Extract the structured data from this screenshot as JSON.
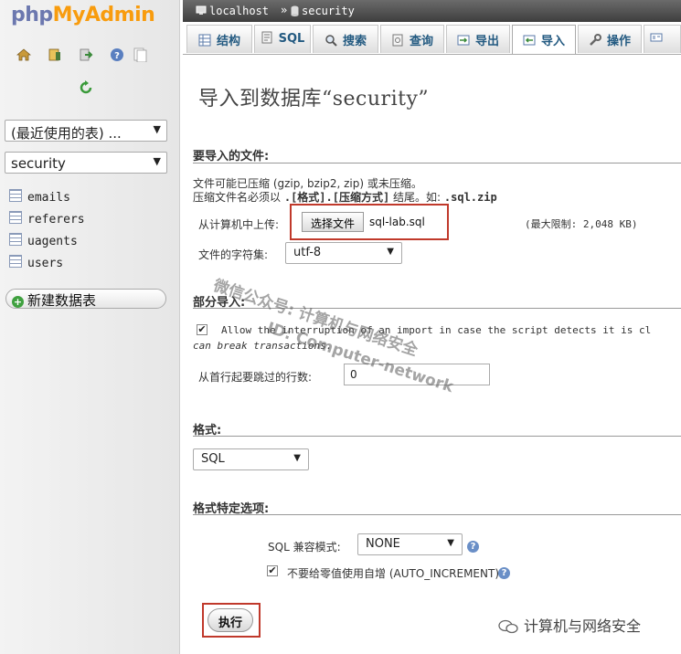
{
  "logo": {
    "php": "php",
    "myadmin": "MyAdmin"
  },
  "nav": {
    "recent_select": "(最近使用的表) ...",
    "db_select": "security",
    "tables": [
      "emails",
      "referers",
      "uagents",
      "users"
    ],
    "new_db": "新建数据表"
  },
  "breadcrumb": {
    "server": "localhost",
    "separator": "»",
    "database": "security"
  },
  "tabs": [
    {
      "label": "结构",
      "icon": "structure-icon"
    },
    {
      "label": "SQL",
      "icon": "sql-icon"
    },
    {
      "label": "搜索",
      "icon": "search-icon"
    },
    {
      "label": "查询",
      "icon": "query-icon"
    },
    {
      "label": "导出",
      "icon": "export-icon"
    },
    {
      "label": "导入",
      "icon": "import-icon",
      "active": true
    },
    {
      "label": "操作",
      "icon": "operations-icon"
    }
  ],
  "heading": "导入到数据库“security”",
  "file_section": {
    "title": "要导入的文件:",
    "line1": "文件可能已压缩 (gzip, bzip2, zip) 或未压缩。",
    "line2_a": "压缩文件名必须以",
    "line2_b": ".[格式].[压缩方式]",
    "line2_c": "结尾。如:",
    "line2_d": ".sql.zip",
    "upload_label": "从计算机中上传:",
    "choose_button": "选择文件",
    "file_name": "sql-lab.sql",
    "max_limit": "(最大限制: 2,048 KB)",
    "charset_label": "文件的字符集:",
    "charset_value": "utf-8"
  },
  "partial_section": {
    "title": "部分导入:",
    "allow_text": "Allow the interruption of an import in case the script detects it is cl",
    "allow_text2": "can break transactions.",
    "allow_checked": true,
    "skip_label": "从首行起要跳过的行数:",
    "skip_value": "0"
  },
  "format_section": {
    "title": "格式:",
    "value": "SQL"
  },
  "options_section": {
    "title": "格式特定选项:",
    "compat_label": "SQL 兼容模式:",
    "compat_value": "NONE",
    "auto_inc_label": "不要给零值使用自增 (AUTO_INCREMENT)",
    "auto_inc_checked": true
  },
  "go_button": "执行",
  "watermark": {
    "line1": "微信公众号: 计算机与网络安全",
    "line2": "ID: Computer-network"
  },
  "footer_watermark": "计算机与网络安全",
  "colors": {
    "accent": "#235a81",
    "highlight_box": "#c0392b",
    "logo_php": "#6c78af",
    "logo_myadmin": "#f89c0e"
  }
}
